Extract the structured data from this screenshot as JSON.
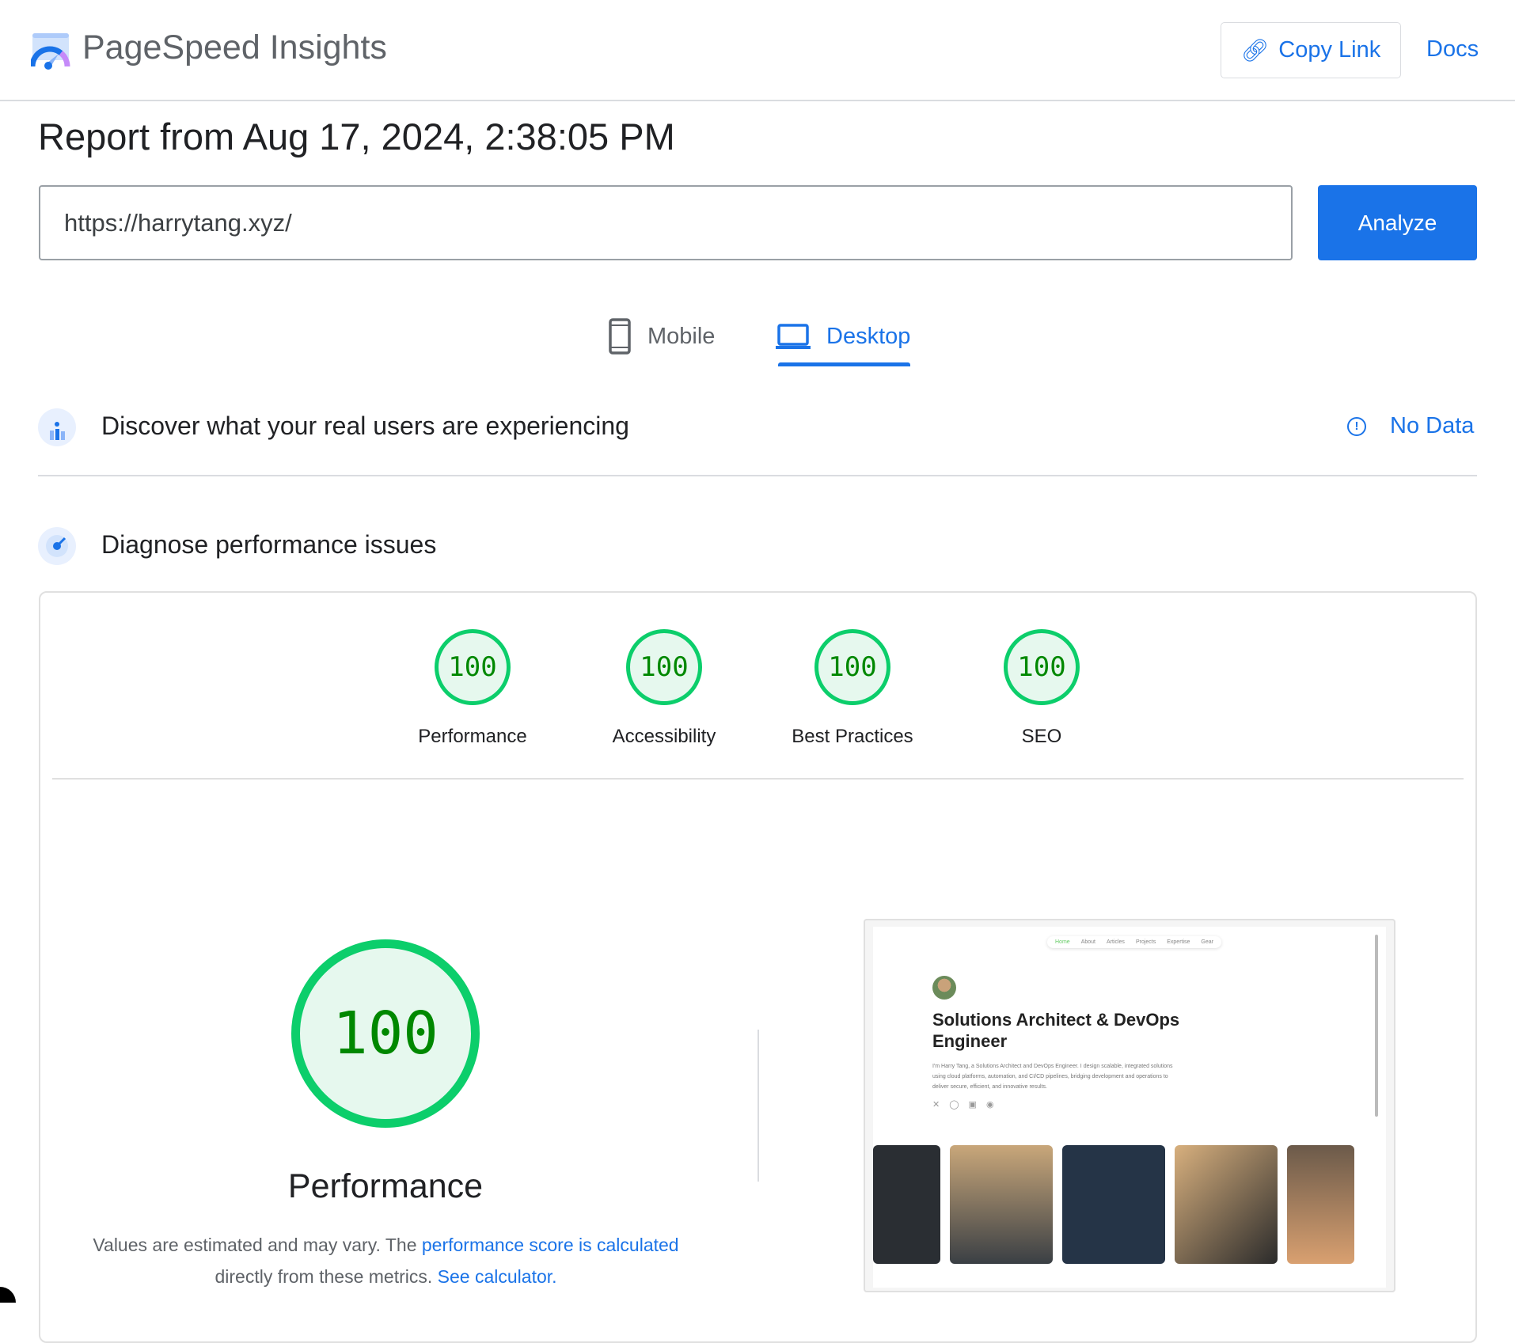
{
  "header": {
    "app_title": "PageSpeed Insights",
    "copy_link": "Copy Link",
    "docs": "Docs"
  },
  "report": {
    "title": "Report from Aug 17, 2024, 2:38:05 PM"
  },
  "url_input": {
    "value": "https://harrytang.xyz/"
  },
  "analyze_label": "Analyze",
  "tabs": [
    {
      "label": "Mobile",
      "active": false
    },
    {
      "label": "Desktop",
      "active": true
    }
  ],
  "field_data": {
    "title": "Discover what your real users are experiencing",
    "status": "No Data"
  },
  "lab": {
    "title": "Diagnose performance issues",
    "scores": [
      {
        "label": "Performance",
        "value": "100"
      },
      {
        "label": "Accessibility",
        "value": "100"
      },
      {
        "label": "Best Practices",
        "value": "100"
      },
      {
        "label": "SEO",
        "value": "100"
      }
    ],
    "main_score": {
      "value": "100",
      "label": "Performance"
    },
    "desc": {
      "text1": "Values are estimated and may vary. The ",
      "link1": "performance score is calculated",
      "text2": " directly from these metrics. ",
      "link2": "See calculator."
    }
  },
  "thumbnail": {
    "nav": [
      "Home",
      "About",
      "Articles",
      "Projects",
      "Expertise",
      "Gear"
    ],
    "title": "Solutions Architect & DevOps Engineer",
    "text": "I'm Harry Tang, a Solutions Architect and DevOps Engineer. I design scalable, integrated solutions using cloud platforms, automation, and CI/CD pipelines, bridging development and operations to deliver secure, efficient, and innovative results."
  },
  "colors": {
    "accent": "#1a73e8",
    "pass": "#0cce6b",
    "pass_text": "#008800"
  }
}
